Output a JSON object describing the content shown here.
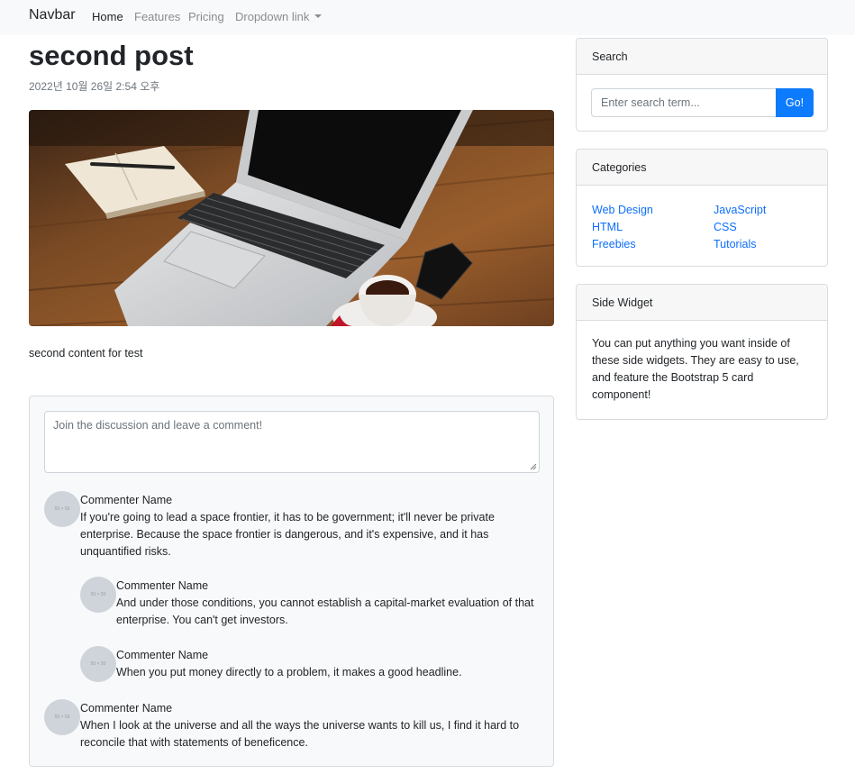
{
  "navbar": {
    "brand": "Navbar",
    "links": [
      {
        "label": "Home",
        "active": true
      },
      {
        "label": "Features",
        "active": false
      },
      {
        "label": "Pricing",
        "active": false
      },
      {
        "label": "Dropdown link",
        "active": false
      }
    ]
  },
  "post": {
    "title": "second post",
    "date": "2022년 10월 26일 2:54 오후",
    "image": "laptop-desk-photo",
    "content": "second content for test"
  },
  "comments": {
    "placeholder": "Join the discussion and leave a comment!",
    "avatar_text": "50 × 50",
    "items": [
      {
        "name": "Commenter Name",
        "text": "If you're going to lead a space frontier, it has to be government; it'll never be private enterprise. Because the space frontier is dangerous, and it's expensive, and it has unquantified risks."
      },
      {
        "name": "Commenter Name",
        "text": "And under those conditions, you cannot establish a capital-market evaluation of that enterprise. You can't get investors."
      },
      {
        "name": "Commenter Name",
        "text": "When you put money directly to a problem, it makes a good headline."
      },
      {
        "name": "Commenter Name",
        "text": "When I look at the universe and all the ways the universe wants to kill us, I find it hard to reconcile that with statements of beneficence."
      }
    ]
  },
  "sidebar": {
    "search": {
      "title": "Search",
      "placeholder": "Enter search term...",
      "button": "Go!"
    },
    "categories": {
      "title": "Categories",
      "left": [
        "Web Design",
        "HTML",
        "Freebies"
      ],
      "right": [
        "JavaScript",
        "CSS",
        "Tutorials"
      ]
    },
    "side_widget": {
      "title": "Side Widget",
      "text": "You can put anything you want inside of these side widgets. They are easy to use, and feature the Bootstrap 5 card component!"
    }
  },
  "colors": {
    "primary": "#0d6efd",
    "button": "#0d7bfd",
    "navbar_bg": "#f8f9fa",
    "card_bg": "#f8f9fa"
  }
}
